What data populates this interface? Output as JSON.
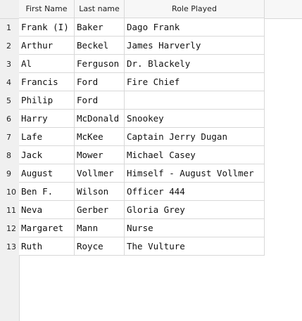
{
  "table": {
    "columns": [
      "First Name",
      "Last name",
      "Role Played"
    ],
    "rows": [
      {
        "num": "1",
        "first": "Frank (I)",
        "last": "Baker",
        "role": "Dago Frank"
      },
      {
        "num": "2",
        "first": "Arthur",
        "last": "Beckel",
        "role": "James Harverly"
      },
      {
        "num": "3",
        "first": "Al",
        "last": "Ferguson",
        "role": "Dr. Blackely"
      },
      {
        "num": "4",
        "first": "Francis",
        "last": "Ford",
        "role": "Fire Chief"
      },
      {
        "num": "5",
        "first": "Philip",
        "last": "Ford",
        "role": ""
      },
      {
        "num": "6",
        "first": "Harry",
        "last": "McDonald",
        "role": "Snookey"
      },
      {
        "num": "7",
        "first": "Lafe",
        "last": "McKee",
        "role": "Captain Jerry Dugan"
      },
      {
        "num": "8",
        "first": "Jack",
        "last": "Mower",
        "role": "Michael Casey"
      },
      {
        "num": "9",
        "first": "August",
        "last": "Vollmer",
        "role": "Himself - August Vollmer"
      },
      {
        "num": "10",
        "first": "Ben F.",
        "last": "Wilson",
        "role": "Officer 444"
      },
      {
        "num": "11",
        "first": "Neva",
        "last": "Gerber",
        "role": "Gloria Grey"
      },
      {
        "num": "12",
        "first": "Margaret",
        "last": "Mann",
        "role": "Nurse"
      },
      {
        "num": "13",
        "first": "Ruth",
        "last": "Royce",
        "role": "The Vulture"
      }
    ]
  }
}
